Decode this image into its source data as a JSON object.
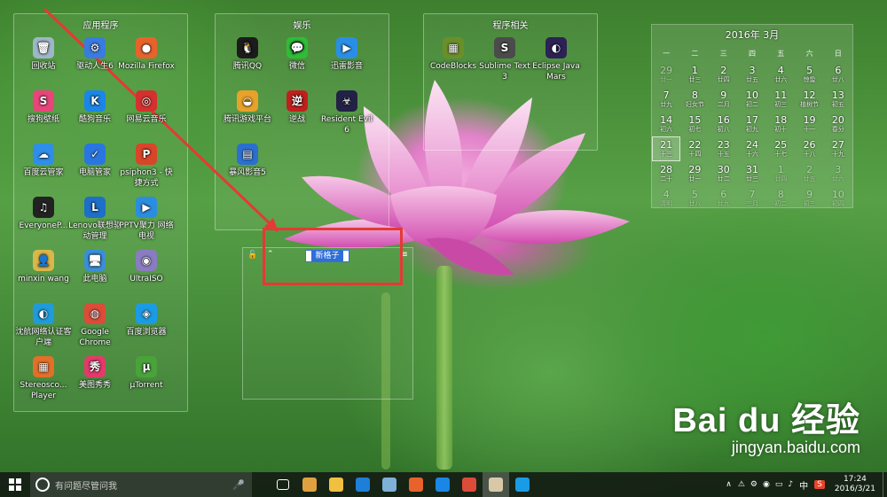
{
  "groups": {
    "apps": {
      "title": "应用程序",
      "items": [
        {
          "label": "回收站",
          "icon": "recycle-bin-icon",
          "color": "#9fb6c8",
          "glyph": "🗑"
        },
        {
          "label": "驱动人生6",
          "icon": "gear-icon",
          "color": "#3a7be0",
          "glyph": "⚙"
        },
        {
          "label": "Mozilla Firefox",
          "icon": "firefox-icon",
          "color": "#e8632b",
          "glyph": "●"
        },
        {
          "label": "搜狗壁纸",
          "icon": "sogou-wallpaper-icon",
          "color": "#e8457a",
          "glyph": "S"
        },
        {
          "label": "酷狗音乐",
          "icon": "kugou-icon",
          "color": "#1b86e6",
          "glyph": "K"
        },
        {
          "label": "网易云音乐",
          "icon": "netease-music-icon",
          "color": "#d4312e",
          "glyph": "◎"
        },
        {
          "label": "百度云管家",
          "icon": "baidu-cloud-icon",
          "color": "#2f8ee8",
          "glyph": "☁"
        },
        {
          "label": "电脑管家",
          "icon": "shield-icon",
          "color": "#2a76e0",
          "glyph": "✓"
        },
        {
          "label": "psiphon3 - 快捷方式",
          "icon": "psiphon-icon",
          "color": "#d8462a",
          "glyph": "P"
        },
        {
          "label": "EveryoneP...",
          "icon": "piano-icon",
          "color": "#222",
          "glyph": "♫"
        },
        {
          "label": "Lenovo联想驱动管理",
          "icon": "lenovo-icon",
          "color": "#1d6fc7",
          "glyph": "L"
        },
        {
          "label": "PPTV聚力 网络电视",
          "icon": "pptv-icon",
          "color": "#2b8de0",
          "glyph": "▶"
        },
        {
          "label": "minxin wang",
          "icon": "user-folder-icon",
          "color": "#d9b74a",
          "glyph": "👤"
        },
        {
          "label": "此电脑",
          "icon": "computer-icon",
          "color": "#3b8fd6",
          "glyph": "🖥"
        },
        {
          "label": "UltraISO",
          "icon": "disc-icon",
          "color": "#8a7cc0",
          "glyph": "◉"
        },
        {
          "label": "沈航网络认证客户端",
          "icon": "network-client-icon",
          "color": "#1f9bdc",
          "glyph": "◐"
        },
        {
          "label": "Google Chrome",
          "icon": "chrome-icon",
          "color": "#dd4b39",
          "glyph": "◍"
        },
        {
          "label": "百度浏览器",
          "icon": "baidu-browser-icon",
          "color": "#1a9be6",
          "glyph": "◈"
        },
        {
          "label": "Stereosco... Player",
          "icon": "cubes-icon",
          "color": "#e0702a",
          "glyph": "▦"
        },
        {
          "label": "美图秀秀",
          "icon": "meitu-icon",
          "color": "#e23b6a",
          "glyph": "秀"
        },
        {
          "label": "µTorrent",
          "icon": "utorrent-icon",
          "color": "#4aa33a",
          "glyph": "µ"
        }
      ]
    },
    "ent": {
      "title": "娱乐",
      "items": [
        {
          "label": "腾讯QQ",
          "icon": "qq-icon",
          "color": "#1c1c1c",
          "glyph": "🐧"
        },
        {
          "label": "微信",
          "icon": "wechat-icon",
          "color": "#2fbd37",
          "glyph": "💬"
        },
        {
          "label": "迅雷影音",
          "icon": "xunlei-icon",
          "color": "#2a8ee6",
          "glyph": "▶"
        },
        {
          "label": "腾讯游戏平台",
          "icon": "tgp-icon",
          "color": "#e8a22a",
          "glyph": "◒"
        },
        {
          "label": "逆战",
          "icon": "nizhan-icon",
          "color": "#c0201e",
          "glyph": "逆"
        },
        {
          "label": "Resident Evil 6",
          "icon": "resident-evil-icon",
          "color": "#222244",
          "glyph": "☣"
        },
        {
          "label": "暴风影音5",
          "icon": "baofeng-icon",
          "color": "#2b6fd0",
          "glyph": "▤"
        }
      ]
    },
    "dev": {
      "title": "程序相关",
      "items": [
        {
          "label": "CodeBlocks",
          "icon": "codeblocks-icon",
          "color": "#6a8f2a",
          "glyph": "▦"
        },
        {
          "label": "Sublime Text 3",
          "icon": "sublime-icon",
          "color": "#4b4b4b",
          "glyph": "S"
        },
        {
          "label": "Eclipse Java Mars",
          "icon": "eclipse-icon",
          "color": "#2c2255",
          "glyph": "◐"
        }
      ]
    }
  },
  "calendar": {
    "header": "2016年 3月",
    "weekdays": [
      "一",
      "二",
      "三",
      "四",
      "五",
      "六",
      "日"
    ],
    "days": [
      {
        "n": "29",
        "l": "廿一",
        "o": true
      },
      {
        "n": "1",
        "l": "廿三"
      },
      {
        "n": "2",
        "l": "廿四"
      },
      {
        "n": "3",
        "l": "廿五"
      },
      {
        "n": "4",
        "l": "廿六"
      },
      {
        "n": "5",
        "l": "惊蛰"
      },
      {
        "n": "6",
        "l": "廿八"
      },
      {
        "n": "7",
        "l": "廿九"
      },
      {
        "n": "8",
        "l": "妇女节"
      },
      {
        "n": "9",
        "l": "二月"
      },
      {
        "n": "10",
        "l": "初二"
      },
      {
        "n": "11",
        "l": "初三"
      },
      {
        "n": "12",
        "l": "植树节"
      },
      {
        "n": "13",
        "l": "初五"
      },
      {
        "n": "14",
        "l": "初六"
      },
      {
        "n": "15",
        "l": "初七"
      },
      {
        "n": "16",
        "l": "初八"
      },
      {
        "n": "17",
        "l": "初九"
      },
      {
        "n": "18",
        "l": "初十"
      },
      {
        "n": "19",
        "l": "十一"
      },
      {
        "n": "20",
        "l": "春分"
      },
      {
        "n": "21",
        "l": "十三",
        "t": true
      },
      {
        "n": "22",
        "l": "十四"
      },
      {
        "n": "23",
        "l": "十五"
      },
      {
        "n": "24",
        "l": "十六"
      },
      {
        "n": "25",
        "l": "十七"
      },
      {
        "n": "26",
        "l": "十八"
      },
      {
        "n": "27",
        "l": "十九"
      },
      {
        "n": "28",
        "l": "二十"
      },
      {
        "n": "29",
        "l": "廿一"
      },
      {
        "n": "30",
        "l": "廿二"
      },
      {
        "n": "31",
        "l": "廿三"
      },
      {
        "n": "1",
        "l": "廿四",
        "o": true
      },
      {
        "n": "2",
        "l": "廿五",
        "o": true
      },
      {
        "n": "3",
        "l": "廿六",
        "o": true
      },
      {
        "n": "4",
        "l": "清明",
        "o": true
      },
      {
        "n": "5",
        "l": "廿八",
        "o": true
      },
      {
        "n": "6",
        "l": "廿九",
        "o": true
      },
      {
        "n": "7",
        "l": "三月",
        "o": true
      },
      {
        "n": "8",
        "l": "初二",
        "o": true
      },
      {
        "n": "9",
        "l": "初三",
        "o": true
      },
      {
        "n": "10",
        "l": "初四",
        "o": true
      }
    ]
  },
  "new_box": {
    "name": "新格子"
  },
  "watermark": {
    "brand": "Bai du 经验",
    "url": "jingyan.baidu.com"
  },
  "taskbar": {
    "search_placeholder": "有问题尽管问我",
    "apps": [
      {
        "name": "task-view-button",
        "color": "transparent"
      },
      {
        "name": "taskbar-app-fences",
        "color": "#e0a040"
      },
      {
        "name": "taskbar-file-explorer",
        "color": "#f0c040"
      },
      {
        "name": "taskbar-edge",
        "color": "#1e7fd8"
      },
      {
        "name": "taskbar-app-2",
        "color": "#7fb0d8"
      },
      {
        "name": "taskbar-firefox",
        "color": "#e8632b"
      },
      {
        "name": "taskbar-kugou",
        "color": "#1b86e6"
      },
      {
        "name": "taskbar-chrome",
        "color": "#dd4b39"
      },
      {
        "name": "taskbar-app-active",
        "color": "#d8c8a8",
        "active": true
      },
      {
        "name": "taskbar-baidu-browser",
        "color": "#1a9be6"
      }
    ],
    "ime": "中",
    "time": "17:24",
    "date": "2016/3/21"
  }
}
